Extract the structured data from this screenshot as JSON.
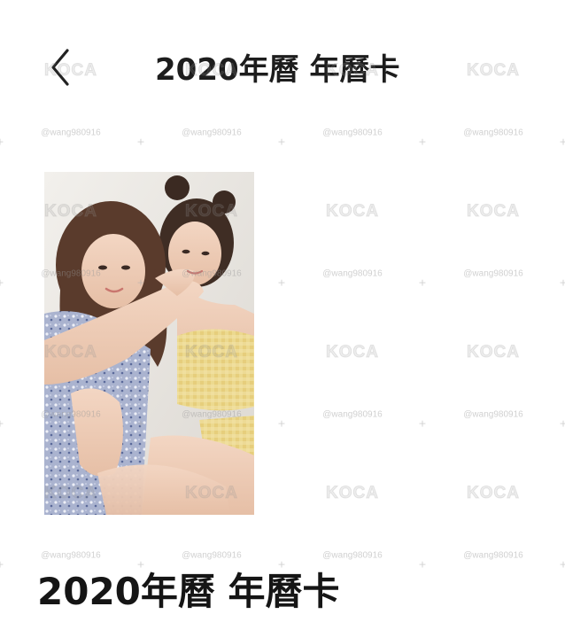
{
  "header": {
    "back_icon": "chevron-left-icon",
    "title": "2020年曆 年曆卡"
  },
  "photocard": {
    "image": "photocard-two-women-hugging",
    "colors": {
      "background": "#eceae7",
      "left_dress": "#a9b2cf",
      "right_top": "#e8d48e",
      "hair": "#4a3428"
    }
  },
  "product": {
    "title": "2020年曆 年曆卡"
  },
  "watermark": {
    "logo": "KOCA",
    "handle": "@wang980916"
  }
}
